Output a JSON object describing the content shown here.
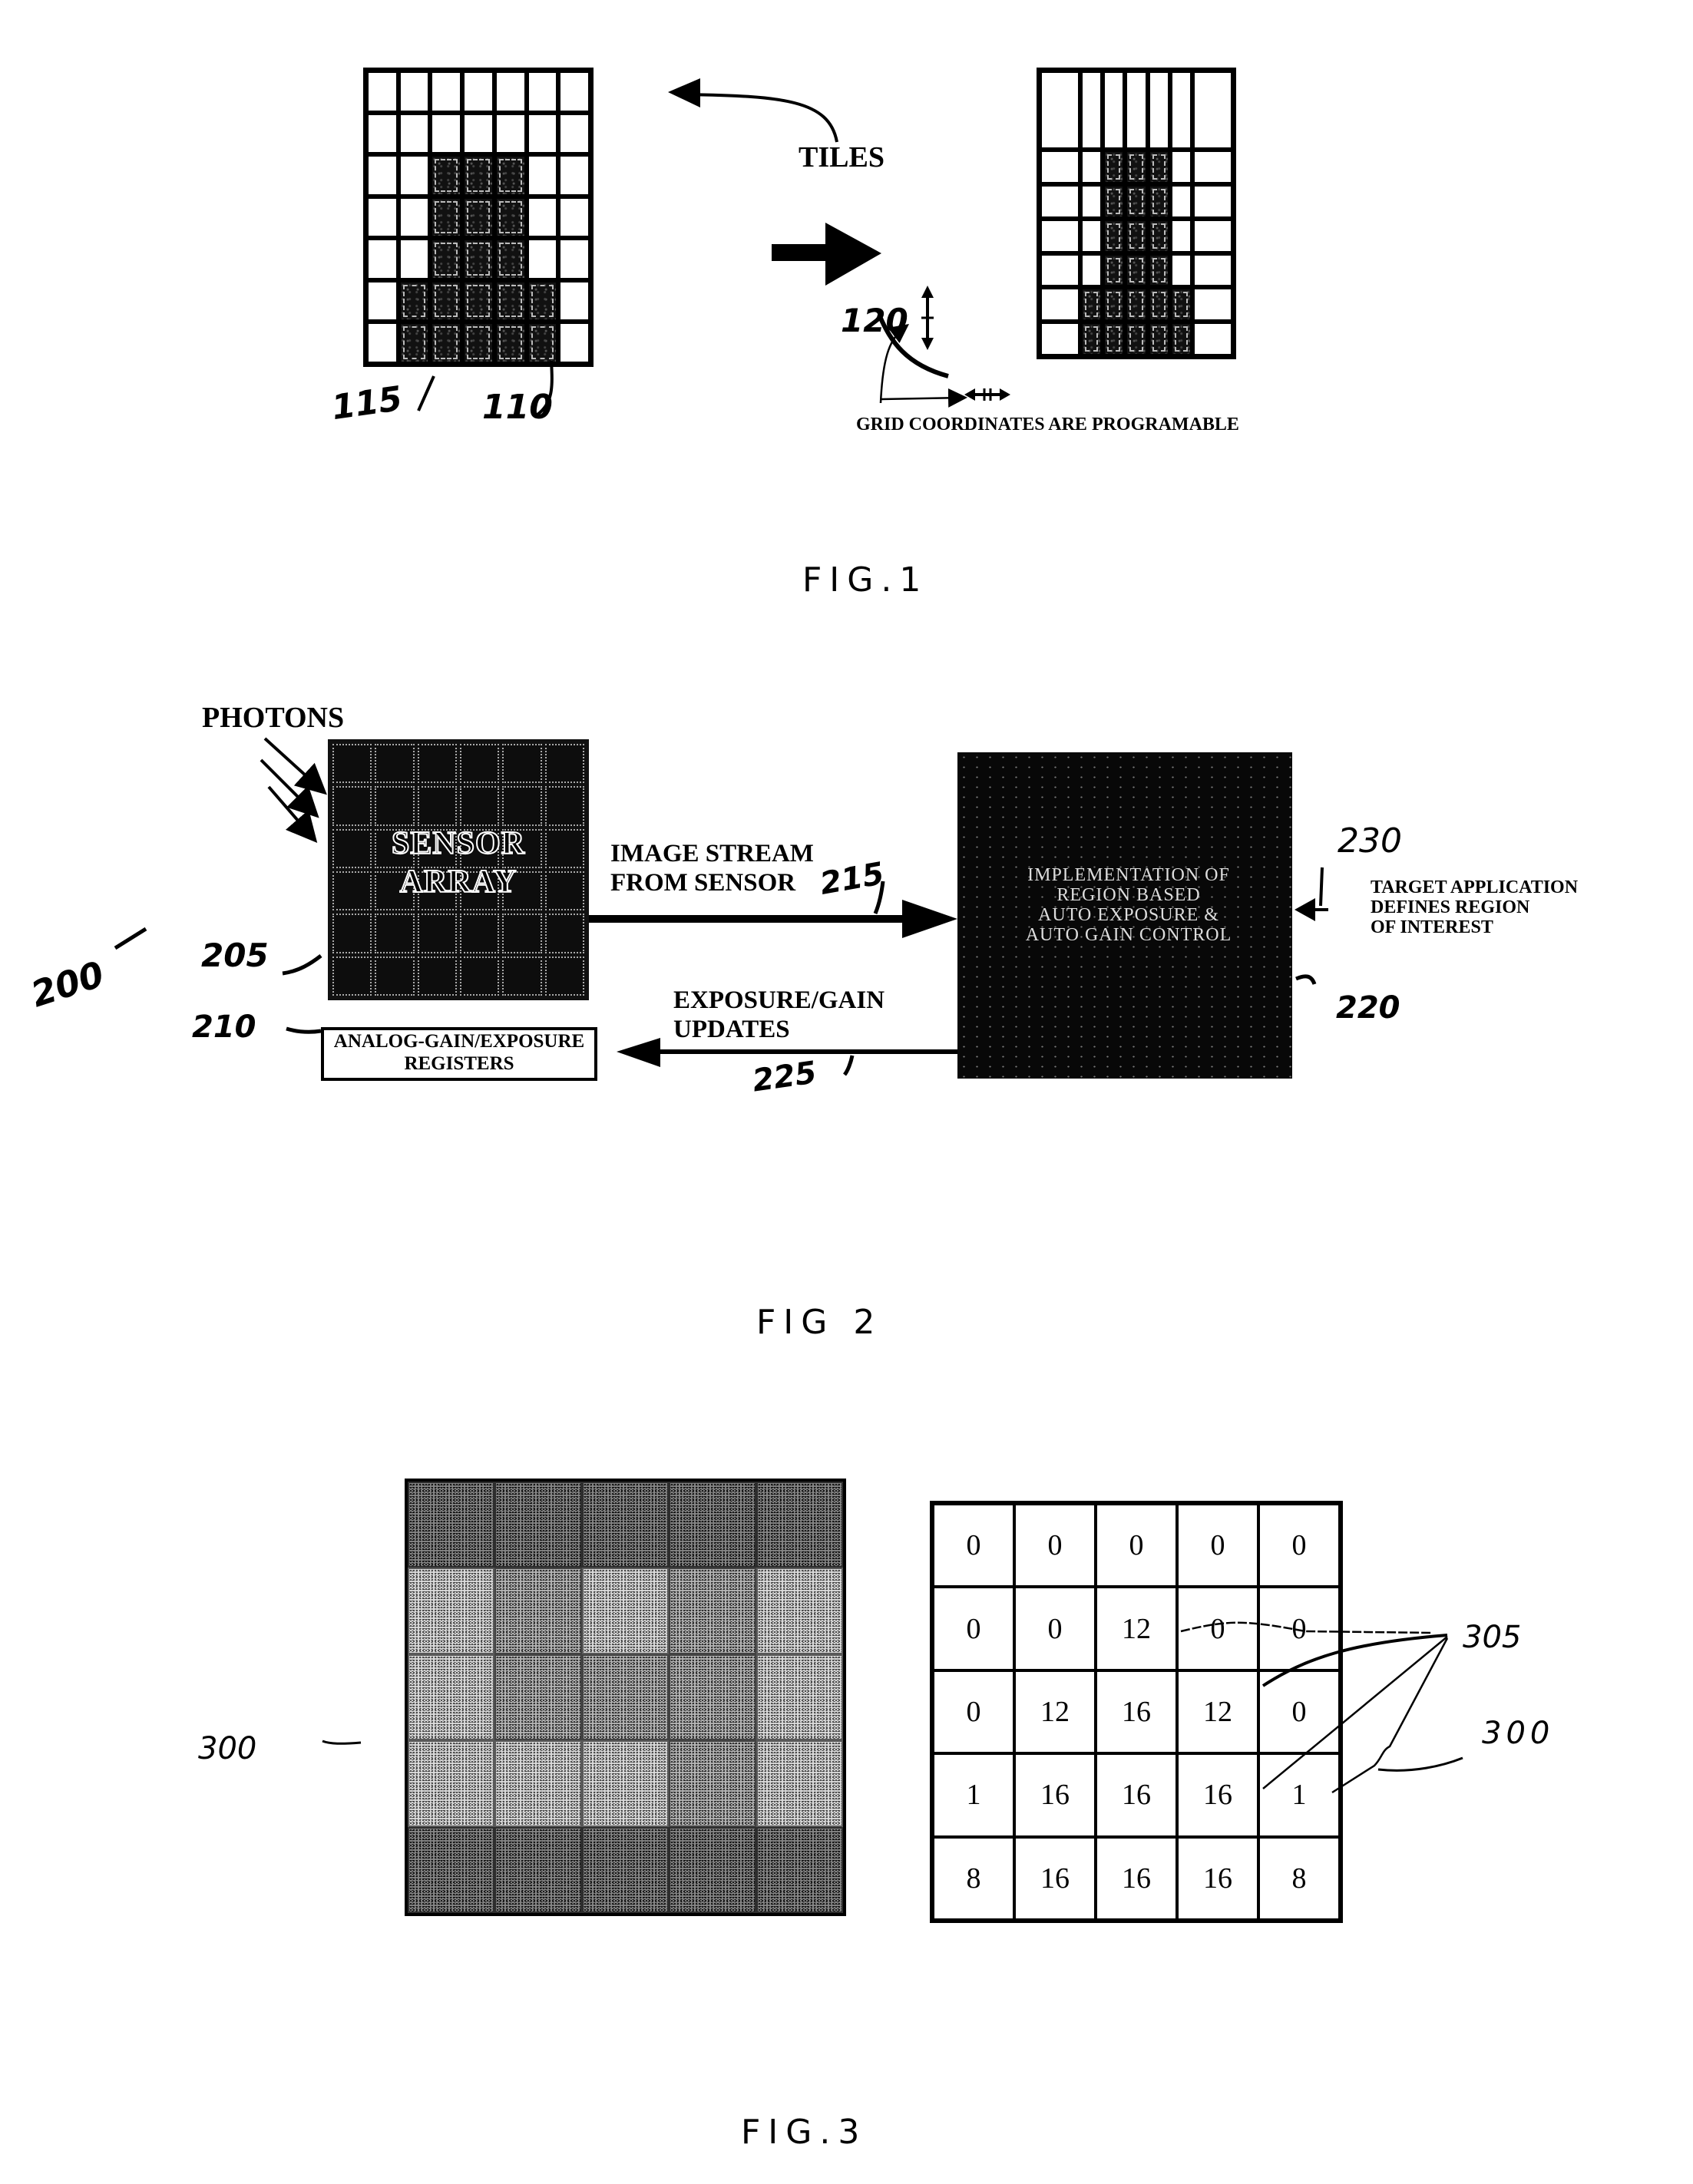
{
  "fig1": {
    "tiles_label": "TILES",
    "ref_115": "115",
    "ref_110": "110",
    "ref_120": "120",
    "grid_note": "GRID COORDINATES ARE PROGRAMABLE",
    "caption": "FIG.1",
    "left_grid": {
      "rows": 7,
      "cols": 7,
      "dark_cells": [
        [
          2,
          2
        ],
        [
          2,
          3
        ],
        [
          2,
          4
        ],
        [
          3,
          2
        ],
        [
          3,
          3
        ],
        [
          3,
          4
        ],
        [
          4,
          2
        ],
        [
          4,
          3
        ],
        [
          4,
          4
        ],
        [
          5,
          1
        ],
        [
          5,
          2
        ],
        [
          5,
          3
        ],
        [
          5,
          4
        ],
        [
          5,
          5
        ],
        [
          6,
          1
        ],
        [
          6,
          2
        ],
        [
          6,
          3
        ],
        [
          6,
          4
        ],
        [
          6,
          5
        ]
      ]
    },
    "right_grid": {
      "rows": 7,
      "cols": 7,
      "dark_cells": [
        [
          1,
          2
        ],
        [
          1,
          3
        ],
        [
          1,
          4
        ],
        [
          2,
          2
        ],
        [
          2,
          3
        ],
        [
          2,
          4
        ],
        [
          3,
          2
        ],
        [
          3,
          3
        ],
        [
          3,
          4
        ],
        [
          4,
          2
        ],
        [
          4,
          3
        ],
        [
          4,
          4
        ],
        [
          5,
          1
        ],
        [
          5,
          2
        ],
        [
          5,
          3
        ],
        [
          5,
          4
        ],
        [
          5,
          5
        ],
        [
          6,
          1
        ],
        [
          6,
          2
        ],
        [
          6,
          3
        ],
        [
          6,
          4
        ],
        [
          6,
          5
        ]
      ]
    }
  },
  "fig2": {
    "photons_label": "PHOTONS",
    "sensor_line1": "SENSOR",
    "sensor_line2": "ARRAY",
    "image_stream_line1": "IMAGE STREAM",
    "image_stream_line2": "FROM SENSOR",
    "ref_215": "215",
    "processor_lines": [
      "IMPLEMENTATION OF",
      "REGION BASED",
      "AUTO EXPOSURE &",
      "AUTO GAIN CONTROL"
    ],
    "ref_230": "230",
    "target_line1": "TARGET APPLICATION",
    "target_line2": "DEFINES REGION",
    "target_line3": "OF INTEREST",
    "ref_220": "220",
    "updates_line1": "EXPOSURE/GAIN",
    "updates_line2": "UPDATES",
    "ref_225": "225",
    "register_line1": "ANALOG-GAIN/EXPOSURE",
    "register_line2": "REGISTERS",
    "ref_200": "200",
    "ref_205": "205",
    "ref_210": "210",
    "caption": "FIG 2"
  },
  "fig3": {
    "ref_300_left": "300",
    "ref_305": "305",
    "ref_300_right": "300",
    "caption": "FIG.3",
    "texture_shades": [
      [
        "d",
        "d",
        "d",
        "d",
        "d"
      ],
      [
        "l",
        "m",
        "l",
        "m",
        "l"
      ],
      [
        "l",
        "m",
        "m",
        "m",
        "l"
      ],
      [
        "l",
        "l",
        "l",
        "m",
        "l"
      ],
      [
        "d",
        "d",
        "d",
        "d",
        "d"
      ]
    ],
    "weights": [
      [
        "0",
        "0",
        "0",
        "0",
        "0"
      ],
      [
        "0",
        "0",
        "12",
        "0",
        "0"
      ],
      [
        "0",
        "12",
        "16",
        "12",
        "0"
      ],
      [
        "1",
        "16",
        "16",
        "16",
        "1"
      ],
      [
        "8",
        "16",
        "16",
        "16",
        "8"
      ]
    ]
  }
}
